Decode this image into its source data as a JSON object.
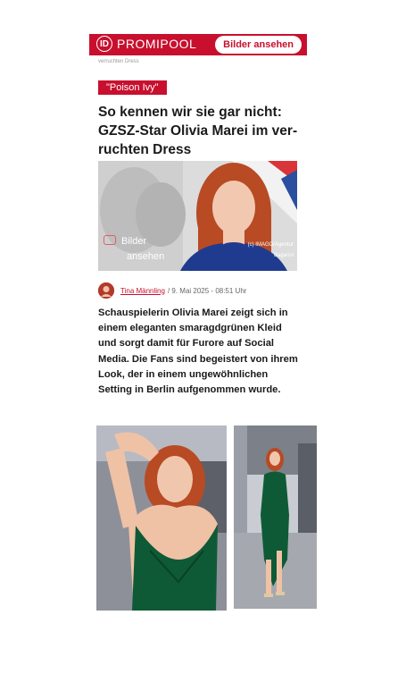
{
  "header": {
    "logo_mark": "ID",
    "logo_text": "PROMIPOOL",
    "gallery_button": "Bilder ansehen"
  },
  "breadcrumb": "verruchten Dress",
  "article": {
    "tag": "\"Poison Ivy\"",
    "title": "So kennen wir sie gar nicht: GZSZ-Star Olivia Marei im ver-ruchten Dress",
    "hero_overlay_line1": "Bilder",
    "hero_overlay_line2": "ansehen",
    "hero_credit_line1": "(c) IMAGO/Agentur",
    "hero_credit_line2": "Bagarini",
    "author": "Tina Männling",
    "date": "/ 9. Mai 2025 - 08:51 Uhr",
    "lead": "Schauspielerin Olivia Marei zeigt sich in einem eleganten smaragdgrünen Kleid und sorgt damit für Furore auf Social Media. Die Fans sind begeistert von ihrem Look, der in einem ungewöhnlichen Setting in Berlin aufgenommen wurde."
  },
  "colors": {
    "brand": "#c8102e",
    "dress": "#0f5a36",
    "hair": "#b84a24"
  },
  "icons": {
    "logo": "promipool-logo-icon",
    "camera": "camera-icon",
    "avatar": "author-avatar"
  }
}
